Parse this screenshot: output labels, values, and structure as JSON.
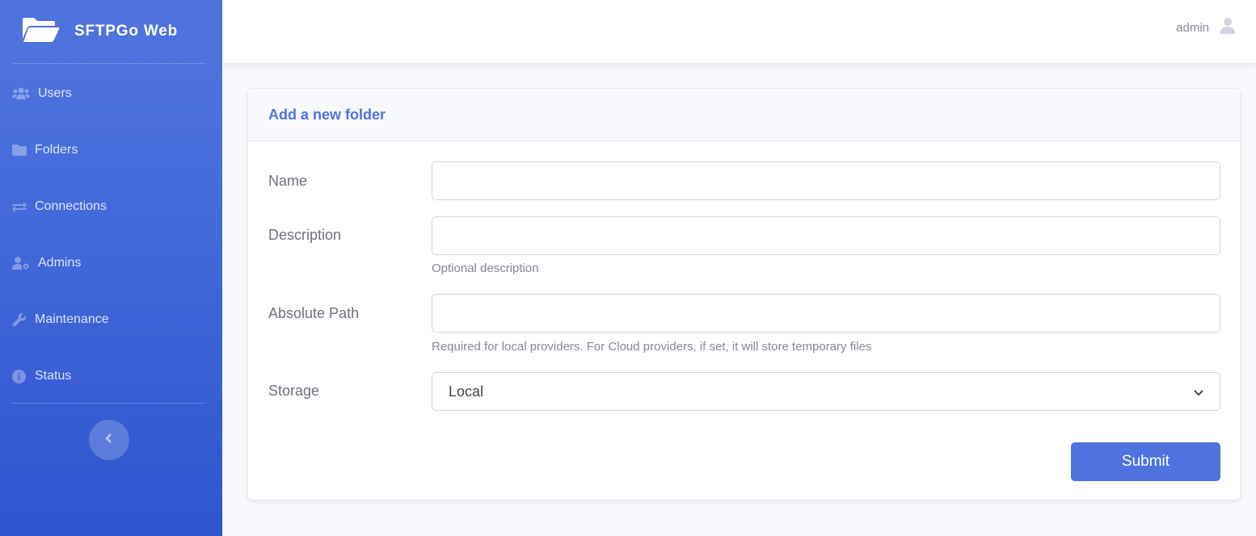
{
  "brand": {
    "title": "SFTPGo Web",
    "icon": "folder-open-icon"
  },
  "sidebar": {
    "items": [
      {
        "label": "Users",
        "icon": "users-icon"
      },
      {
        "label": "Folders",
        "icon": "folder-icon"
      },
      {
        "label": "Connections",
        "icon": "exchange-icon"
      },
      {
        "label": "Admins",
        "icon": "user-cog-icon"
      },
      {
        "label": "Maintenance",
        "icon": "wrench-icon"
      },
      {
        "label": "Status",
        "icon": "info-circle-icon"
      }
    ],
    "toggle_icon": "chevron-left-icon"
  },
  "topbar": {
    "username": "admin",
    "avatar_icon": "user-icon"
  },
  "form": {
    "title": "Add a new folder",
    "name_label": "Name",
    "name_value": "",
    "description_label": "Description",
    "description_value": "",
    "description_help": "Optional description",
    "path_label": "Absolute Path",
    "path_value": "",
    "path_help": "Required for local providers. For Cloud providers, if set, it will store temporary files",
    "storage_label": "Storage",
    "storage_selected": "Local",
    "submit_label": "Submit"
  },
  "colors": {
    "primary": "#4e73df",
    "sidebar_bottom": "#2f55d0",
    "text_muted": "#858796"
  }
}
